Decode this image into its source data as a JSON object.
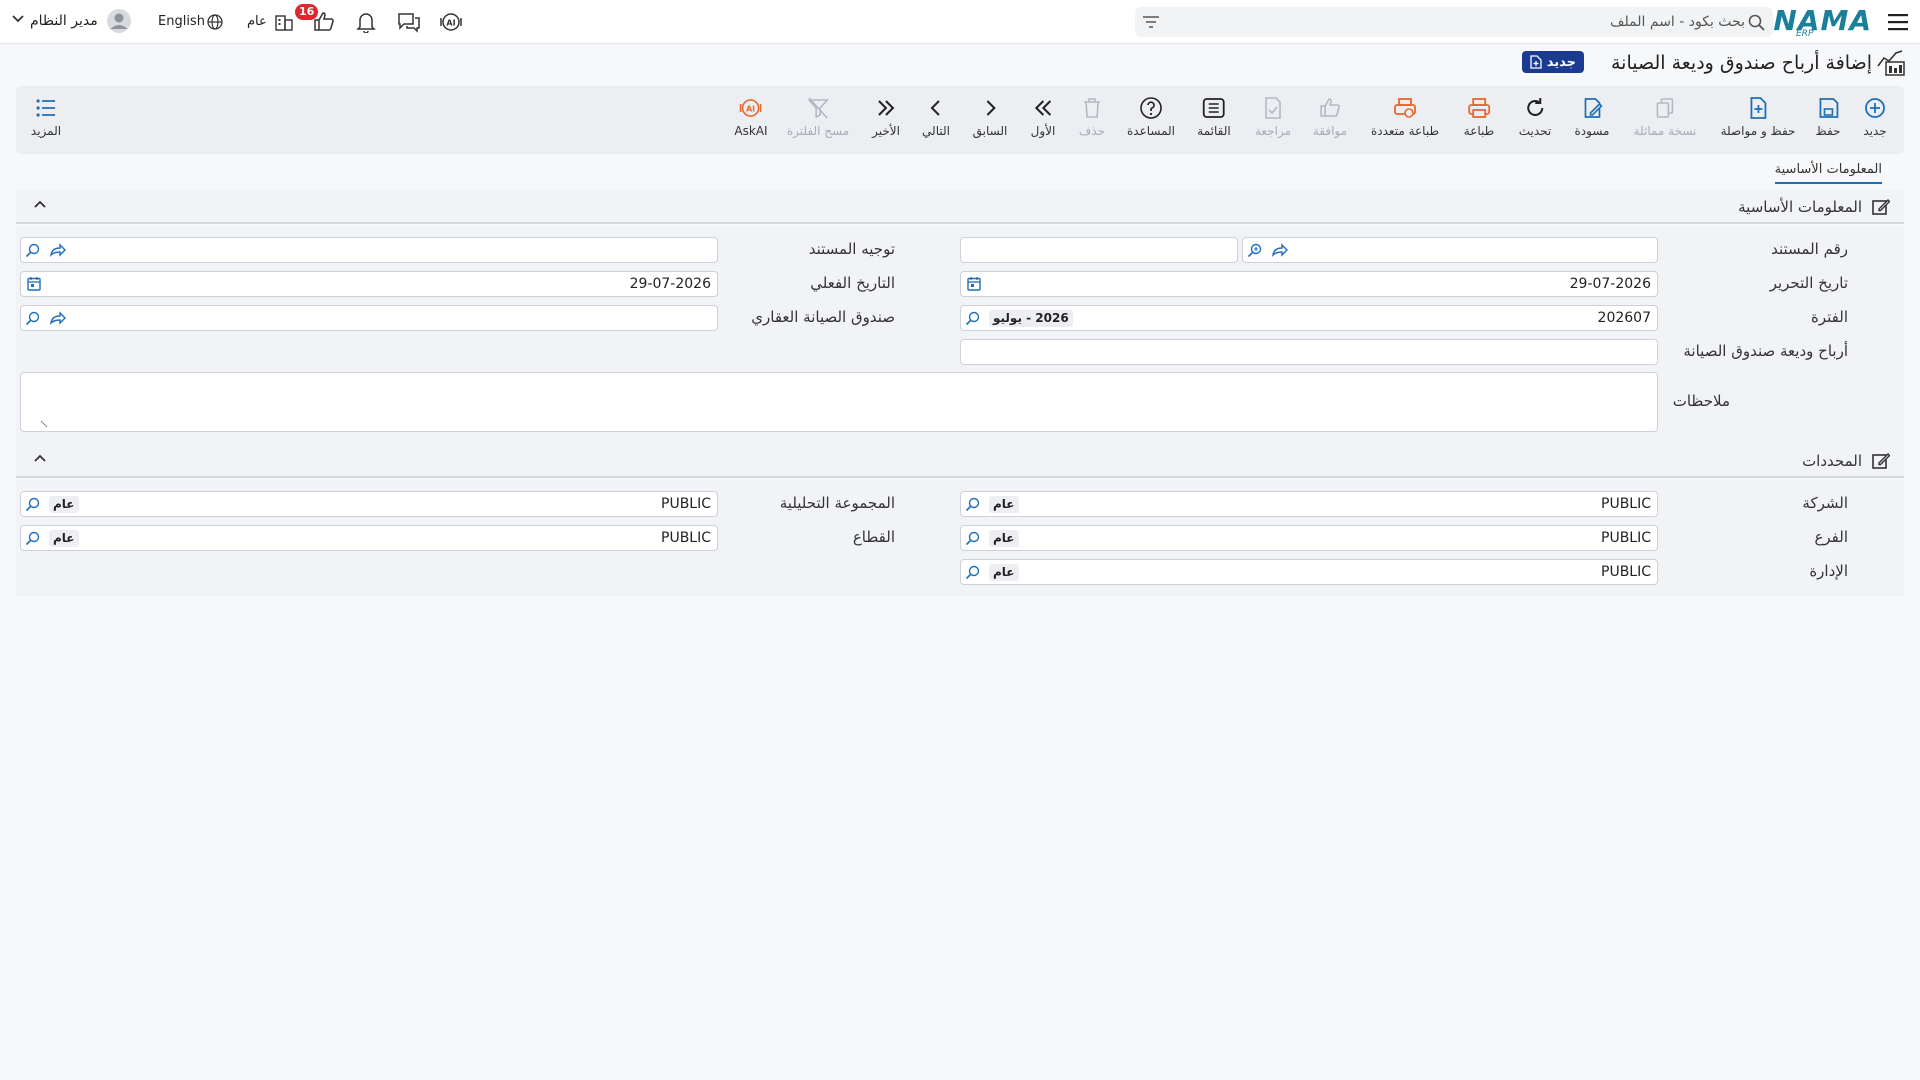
{
  "header": {
    "logo_text": "NAMA",
    "logo_sub": "ERP",
    "search_placeholder": "بحث بكود - اسم الملف",
    "language_label": "English",
    "user_name": "مدير النظام",
    "company_label": "عام",
    "notification_count": "16"
  },
  "page": {
    "title": "إضافة أرباح صندوق وديعة الصيانة",
    "status_badge": "جديد"
  },
  "toolbar": {
    "items": [
      {
        "label": "جديد",
        "icon": "plus-circle-icon",
        "enabled": true
      },
      {
        "label": "حفظ",
        "icon": "save-icon",
        "enabled": true
      },
      {
        "label": "حفظ و مواصلة",
        "icon": "save-continue-icon",
        "enabled": true
      },
      {
        "label": "نسخة مماثلة",
        "icon": "copy-icon",
        "enabled": false
      },
      {
        "label": "مسودة",
        "icon": "draft-icon",
        "enabled": true
      },
      {
        "label": "تحديث",
        "icon": "refresh-icon",
        "enabled": true
      },
      {
        "label": "طباعة",
        "icon": "print-icon",
        "enabled": true
      },
      {
        "label": "طباعة متعددة",
        "icon": "multi-print-icon",
        "enabled": true
      },
      {
        "label": "موافقة",
        "icon": "thumbs-up-icon",
        "enabled": false
      },
      {
        "label": "مراجعة",
        "icon": "review-icon",
        "enabled": false
      },
      {
        "label": "القائمة",
        "icon": "list-icon",
        "enabled": true
      },
      {
        "label": "المساعدة",
        "icon": "help-icon",
        "enabled": true
      },
      {
        "label": "حذف",
        "icon": "trash-icon",
        "enabled": false
      },
      {
        "label": "الأول",
        "icon": "first-icon",
        "enabled": true
      },
      {
        "label": "السابق",
        "icon": "previous-icon",
        "enabled": true
      },
      {
        "label": "التالي",
        "icon": "next-icon",
        "enabled": true
      },
      {
        "label": "الأخير",
        "icon": "last-icon",
        "enabled": true
      },
      {
        "label": "مسح الفلترة",
        "icon": "clear-filter-icon",
        "enabled": false
      },
      {
        "label": "AskAI",
        "icon": "ai-icon",
        "enabled": true
      }
    ],
    "more_label": "المزيد"
  },
  "tabs": {
    "active": "المعلومات الأساسية"
  },
  "basic_section": {
    "title": "المعلومات الأساسية",
    "fields": {
      "doc_number": {
        "label": "رقم المستند",
        "value": ""
      },
      "doc_direction": {
        "label": "توجيه المستند",
        "value": ""
      },
      "issue_date": {
        "label": "تاريخ التحرير",
        "value": "29-07-2026"
      },
      "actual_date": {
        "label": "التاريخ الفعلي",
        "value": "29-07-2026"
      },
      "period": {
        "label": "الفترة",
        "value": "202607",
        "chip": "2026 - يوليو"
      },
      "maintenance_fund": {
        "label": "صندوق الصيانة العقاري",
        "value": ""
      },
      "fund_profits": {
        "label": "أرباح وديعة صندوق الصيانة",
        "value": ""
      },
      "notes": {
        "label": "ملاحظات",
        "value": ""
      }
    }
  },
  "dimensions_section": {
    "title": "المحددات",
    "fields": {
      "company": {
        "label": "الشركة",
        "value": "PUBLIC",
        "chip": "عام"
      },
      "analytic_group": {
        "label": "المجموعة التحليلية",
        "value": "PUBLIC",
        "chip": "عام"
      },
      "branch": {
        "label": "الفرع",
        "value": "PUBLIC",
        "chip": "عام"
      },
      "sector": {
        "label": "القطاع",
        "value": "PUBLIC",
        "chip": "عام"
      },
      "department": {
        "label": "الإدارة",
        "value": "PUBLIC",
        "chip": "عام"
      }
    }
  },
  "colors": {
    "accent": "#1f6fb8",
    "print_orange": "#e8672b",
    "badge_red": "#e0262f",
    "logo_teal": "#1b7f9a",
    "title_pill": "#1a3b8f"
  }
}
